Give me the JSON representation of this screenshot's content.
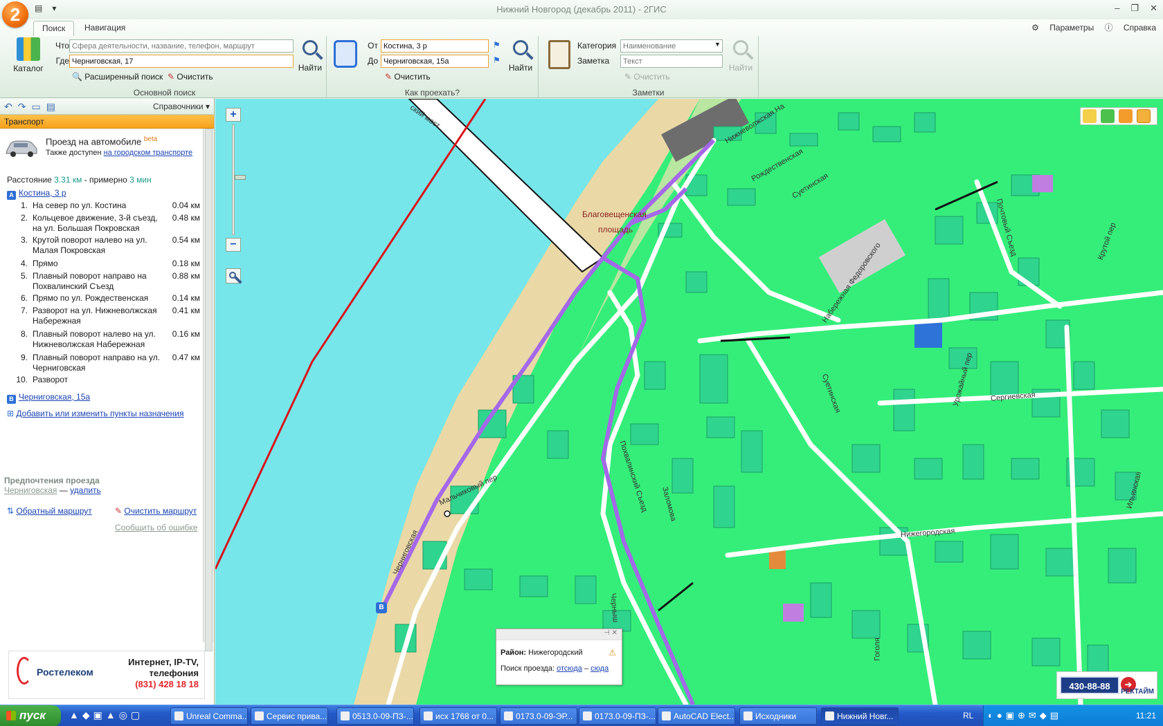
{
  "window": {
    "title": "Нижний Новгород (декабрь 2011) - 2ГИС"
  },
  "ribbon": {
    "tabs": [
      {
        "label": "Поиск"
      },
      {
        "label": "Навигация"
      }
    ],
    "params_label": "Параметры",
    "help_label": "Справка",
    "main_search": {
      "catalog_label": "Каталог",
      "what_label": "Что",
      "what_placeholder": "Сфера деятельности, название, телефон, маршрут",
      "where_label": "Где",
      "where_value": "Черниговская, 17",
      "find_label": "Найти",
      "advanced_label": "Расширенный поиск",
      "clear_label": "Очистить",
      "group_label": "Основной поиск"
    },
    "route": {
      "from_label": "От",
      "from_value": "Костина, 3 р",
      "to_label": "До",
      "to_value": "Черниговская, 15а",
      "find_label": "Найти",
      "clear_label": "Очистить",
      "group_label": "Как проехать?"
    },
    "notes": {
      "category_label": "Категория",
      "category_placeholder": "Наименование",
      "note_label": "Заметка",
      "note_placeholder": "Текст",
      "clear_label": "Очистить",
      "find_label": "Найти",
      "group_label": "Заметки"
    }
  },
  "left_panel": {
    "directories_label": "Справочники",
    "header": "Транспорт",
    "mode_title": "Проезд на автомобиле",
    "mode_beta": "beta",
    "also_text": "Также доступен",
    "also_link": "на городском транспорте",
    "distance_prefix": "Расстояние",
    "distance_value": "3.31 км",
    "distance_mid": "- примерно",
    "time_value": "3 мин",
    "start_point": "Костина, 3 р",
    "start_badge": "A",
    "steps": [
      {
        "n": "1.",
        "text": "На север по ул. Костина",
        "dist": "0.04 км"
      },
      {
        "n": "2.",
        "text": "Кольцевое движение, 3-й съезд, на ул. Большая Покровская",
        "dist": "0.48 км"
      },
      {
        "n": "3.",
        "text": "Крутой поворот налево на ул. Малая Покровская",
        "dist": "0.54 км"
      },
      {
        "n": "4.",
        "text": "Прямо",
        "dist": "0.18 км"
      },
      {
        "n": "5.",
        "text": "Плавный поворот направо на Похвалинский Съезд",
        "dist": "0.88 км"
      },
      {
        "n": "6.",
        "text": "Прямо по ул. Рождественская",
        "dist": "0.14 км"
      },
      {
        "n": "7.",
        "text": "Разворот на ул. Нижневолжская Набережная",
        "dist": "0.41 км"
      },
      {
        "n": "8.",
        "text": "Плавный поворот налево на ул. Нижневолжская Набережная",
        "dist": "0.16 км"
      },
      {
        "n": "9.",
        "text": "Плавный поворот направо на ул. Черниговская",
        "dist": "0.47 км"
      },
      {
        "n": "10.",
        "text": "Разворот",
        "dist": ""
      }
    ],
    "end_point": "Черниговская, 15а",
    "end_badge": "B",
    "add_points_link": "Добавить или изменить пункты назначения",
    "prefs_title": "Предпочтения проезда",
    "pref_street": "Черниговская",
    "pref_dash": "—",
    "pref_delete": "удалить",
    "reverse_route": "Обратный маршрут",
    "clear_route": "Очистить маршрут",
    "report_error": "Сообщить об ошибке",
    "ad": {
      "brand": "Ростелеком",
      "line1": "Интернет, IP-TV,",
      "line2": "телефония",
      "phone": "(831) 428 18 18"
    }
  },
  "map": {
    "labels": [
      "Благовещенская",
      "площадь"
    ],
    "streets": [
      "Нижневолжская На",
      "Рождественская",
      "Суетинская",
      "Почтовый Съезд",
      "Крутой пер",
      "Набережная Федоровского",
      "Суетинская",
      "Сергиевская",
      "Урожайный пер",
      "Похвалинский Съезд",
      "Заломова",
      "Нижегородская",
      "Ильинская",
      "Черниговская",
      "Мальчиковый пер",
      "Гоголя",
      "Черныш",
      "ский мост"
    ],
    "popup": {
      "district_label": "Район:",
      "district_value": "Нижегородский",
      "route_label": "Поиск проезда:",
      "from_link": "отсюда",
      "dash": "–",
      "to_link": "сюда"
    },
    "ad": {
      "phone": "430-88-88",
      "brand": "РЕКТАЙМ"
    },
    "route_marker": "B"
  },
  "taskbar": {
    "start": "пуск",
    "tasks": [
      "Unreal Comma...",
      "Сервис прива...",
      "0513.0-09-ПЗ-...",
      "исх 1768 от 0...",
      "0173.0-09-ЭР...",
      "0173.0-09-ПЗ-...",
      "AutoCAD Elect...",
      "Исходники",
      "Нижний Новг..."
    ],
    "lang": "RL",
    "clock": "11:21"
  }
}
